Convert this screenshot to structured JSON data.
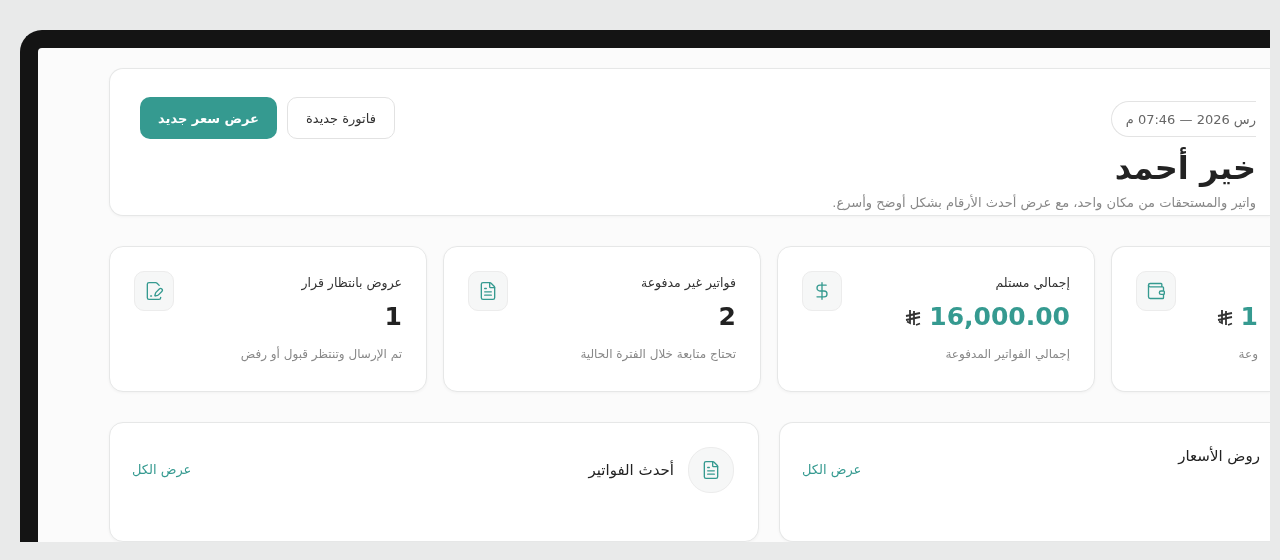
{
  "header": {
    "date": "رس 2026 — 07:46 م",
    "title": "خير أحمد",
    "subtitle": "واتير والمستحقات من مكان واحد، مع عرض أحدث الأرقام بشكل أوضح وأسرع.",
    "buttons": [
      {
        "label": "فاتورة جديدة",
        "kind": "secondary"
      },
      {
        "label": "عرض سعر جديد",
        "kind": "primary"
      }
    ]
  },
  "stats": [
    {
      "value": "1",
      "note": "وعة",
      "kind": "amount"
    },
    {
      "label": "إجمالي مستلم",
      "value": "16,000.00",
      "note": "إجمالي الفواتير المدفوعة",
      "kind": "amount"
    },
    {
      "label": "فواتير غير مدفوعة",
      "value": "2",
      "note": "تحتاج متابعة خلال الفترة الحالية",
      "kind": "count"
    },
    {
      "label": "عروض بانتظار قرار",
      "value": "1",
      "note": "تم الإرسال وتنتظر قبول أو رفض",
      "kind": "count"
    }
  ],
  "panels": [
    {
      "title": "روض الأسعار",
      "link": "عرض الكل"
    },
    {
      "title": "أحدث الفواتير",
      "link": "عرض الكل"
    }
  ]
}
